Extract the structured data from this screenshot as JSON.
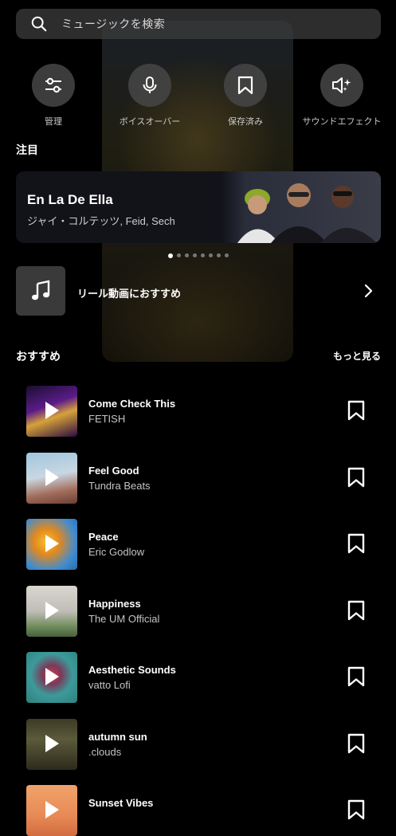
{
  "search": {
    "placeholder": "ミュージックを検索"
  },
  "actions": [
    {
      "label": "管理",
      "icon": "sliders-icon"
    },
    {
      "label": "ボイスオーバー",
      "icon": "microphone-icon"
    },
    {
      "label": "保存済み",
      "icon": "bookmark-icon"
    },
    {
      "label": "サウンドエフェクト",
      "icon": "sound-effect-icon"
    }
  ],
  "featured_section": {
    "title": "注目"
  },
  "featured": {
    "title": "En La De Ella",
    "artists": "ジャイ・コルテッツ, Feid, Sech",
    "page_count": 8,
    "active_page": 1
  },
  "reel": {
    "label": "リール動画におすすめ"
  },
  "recommended": {
    "title": "おすすめ",
    "more": "もっと見る"
  },
  "tracks": [
    {
      "title": "Come Check This",
      "artist": "FETISH"
    },
    {
      "title": "Feel Good",
      "artist": "Tundra Beats"
    },
    {
      "title": "Peace",
      "artist": "Eric Godlow"
    },
    {
      "title": "Happiness",
      "artist": "The UM Official"
    },
    {
      "title": "Aesthetic Sounds",
      "artist": "vatto Lofi"
    },
    {
      "title": "autumn sun",
      "artist": ".clouds"
    },
    {
      "title": "Sunset Vibes",
      "artist": ""
    }
  ]
}
